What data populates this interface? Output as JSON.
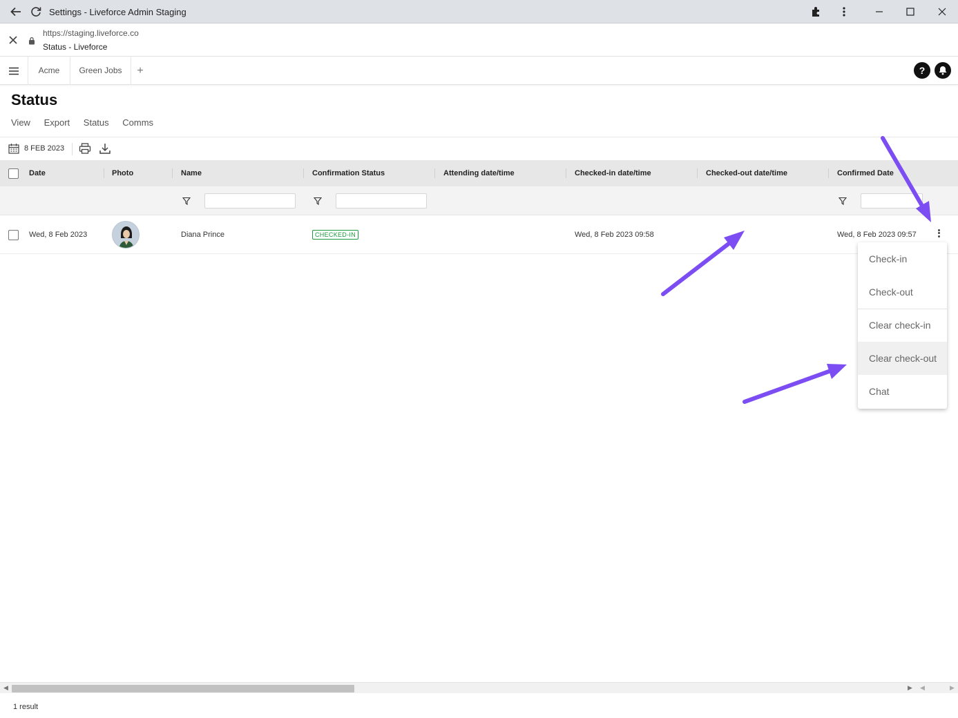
{
  "window": {
    "title": "Settings - Liveforce Admin Staging",
    "url": "https://staging.liveforce.co",
    "page_name": "Status - Liveforce"
  },
  "app_tabs": [
    {
      "label": "Acme"
    },
    {
      "label": "Green Jobs"
    }
  ],
  "add_tab_label": "+",
  "help_label": "?",
  "page": {
    "title": "Status",
    "subnav": [
      "View",
      "Export",
      "Status",
      "Comms"
    ]
  },
  "toolbar": {
    "date": "8 FEB 2023"
  },
  "table": {
    "columns": [
      "Date",
      "Photo",
      "Name",
      "Confirmation Status",
      "Attending date/time",
      "Checked-in date/time",
      "Checked-out date/time",
      "Confirmed Date"
    ],
    "rows": [
      {
        "date": "Wed, 8 Feb 2023",
        "name": "Diana Prince",
        "status": "CHECKED-IN",
        "attending": "",
        "checked_in": "Wed, 8 Feb 2023 09:58",
        "checked_out": "",
        "confirmed": "Wed, 8 Feb 2023 09:57"
      }
    ]
  },
  "context_menu": {
    "items": [
      "Check-in",
      "Check-out",
      "Clear check-in",
      "Clear check-out",
      "Chat"
    ],
    "hovered": "Clear check-out"
  },
  "footer": {
    "result_count": "1 result"
  },
  "colors": {
    "annotation_arrow": "#7b4df2",
    "status_green": "#1d9a3c",
    "header_bg": "#e7e7e7"
  }
}
